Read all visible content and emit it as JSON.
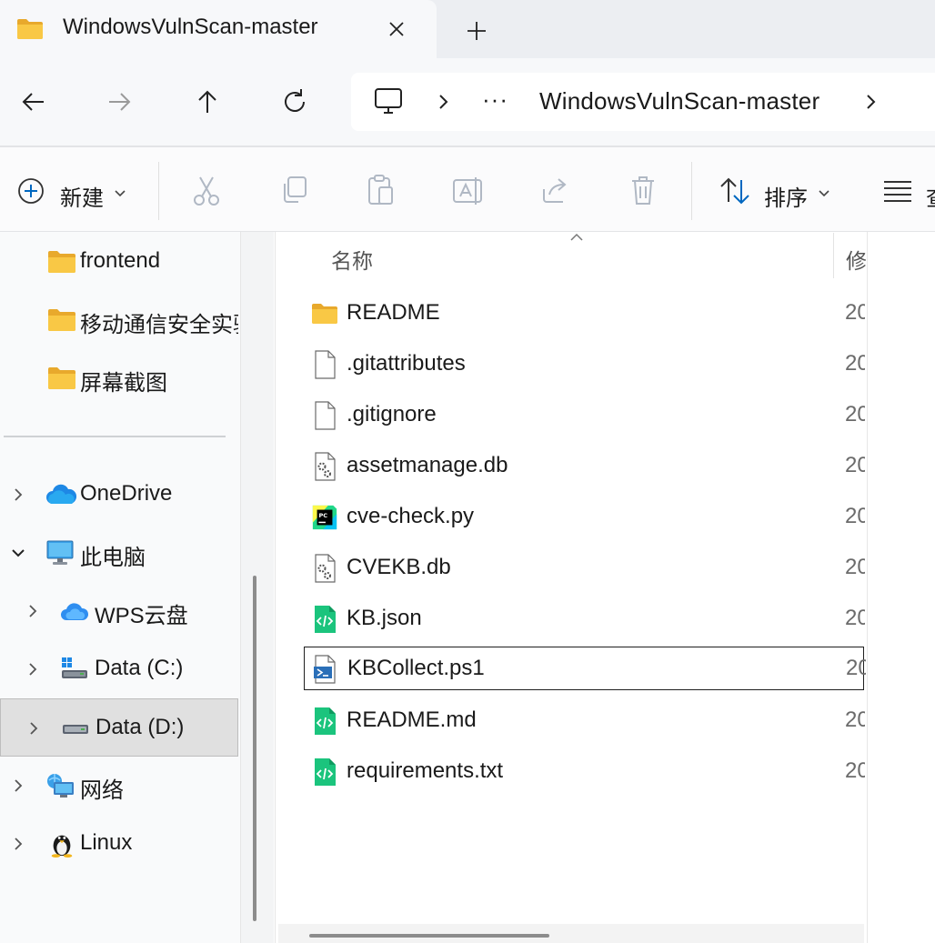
{
  "window": {
    "tab_title": "WindowsVulnScan-master"
  },
  "address_bar": {
    "ellipsis": "···",
    "current_folder": "WindowsVulnScan-master"
  },
  "command_bar": {
    "new_label": "新建",
    "sort_label": "排序",
    "view_label_partial": "查"
  },
  "nav_pane": {
    "quick_items": [
      {
        "label": "frontend",
        "icon": "folder-icon"
      },
      {
        "label": "移动通信安全实验",
        "icon": "folder-icon"
      },
      {
        "label": "屏幕截图",
        "icon": "folder-icon"
      }
    ],
    "tree_items": [
      {
        "label": "OneDrive",
        "icon": "onedrive-cloud-icon",
        "expanded": false
      },
      {
        "label": "此电脑",
        "icon": "this-pc-icon",
        "expanded": true
      },
      {
        "label": "WPS云盘",
        "icon": "wps-cloud-icon",
        "expanded": false
      },
      {
        "label": "Data (C:)",
        "icon": "system-drive-icon",
        "expanded": false
      },
      {
        "label": "Data (D:)",
        "icon": "drive-icon",
        "expanded": false,
        "selected": true
      },
      {
        "label": "网络",
        "icon": "network-icon",
        "expanded": false
      },
      {
        "label": "Linux",
        "icon": "linux-penguin-icon",
        "expanded": false
      }
    ]
  },
  "file_list": {
    "columns": {
      "name": "名称",
      "modified": "修"
    },
    "files": [
      {
        "name": "README",
        "type": "folder",
        "date": "20"
      },
      {
        "name": ".gitattributes",
        "type": "file",
        "date": "20"
      },
      {
        "name": ".gitignore",
        "type": "file",
        "date": "20"
      },
      {
        "name": "assetmanage.db",
        "type": "db",
        "date": "20"
      },
      {
        "name": "cve-check.py",
        "type": "pycharm",
        "date": "20"
      },
      {
        "name": "CVEKB.db",
        "type": "db",
        "date": "20"
      },
      {
        "name": "KB.json",
        "type": "code",
        "date": "20"
      },
      {
        "name": "KBCollect.ps1",
        "type": "powershell",
        "date": "20",
        "focused": true
      },
      {
        "name": "README.md",
        "type": "code",
        "date": "20"
      },
      {
        "name": "requirements.txt",
        "type": "code",
        "date": "20"
      }
    ]
  },
  "colors": {
    "accent": "#0067c0",
    "folder_yellow": "#f9c845",
    "code_green": "#1bc47d",
    "selected_bg": "#e0e0e0"
  }
}
